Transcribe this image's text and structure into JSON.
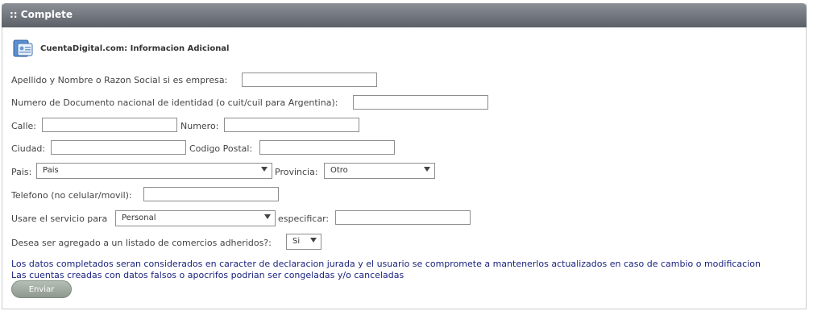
{
  "header": {
    "title": ":: Complete"
  },
  "brand": {
    "text": "CuentaDigital.com: Informacion Adicional",
    "icon": "id-card-icon"
  },
  "form": {
    "nombre_label": "Apellido y Nombre o Razon Social si es empresa:",
    "documento_label": "Numero de Documento nacional de identidad (o cuit/cuil para Argentina):",
    "calle_label": "Calle:",
    "numero_label": "Numero:",
    "ciudad_label": "Ciudad:",
    "codigo_postal_label": "Codigo Postal:",
    "pais_label": "Pais:",
    "pais_value": "Pais",
    "provincia_label": "Provincia:",
    "provincia_value": "Otro",
    "telefono_label": "Telefono (no celular/movil):",
    "servicio_label": "Usare el servicio para",
    "servicio_value": "Personal",
    "especificar_label": "especificar:",
    "listado_label": "Desea ser agregado a un listado de comercios adheridos?:",
    "listado_value": "Si"
  },
  "notice": {
    "line1": "Los datos completados seran considerados en caracter de declaracion jurada y el usuario se compromete a mantenerlos actualizados en caso de cambio o modificacion",
    "line2": "Las cuentas creadas con datos falsos o apocrifos podrian ser congeladas y/o canceladas"
  },
  "submit": {
    "label": "Enviar"
  }
}
